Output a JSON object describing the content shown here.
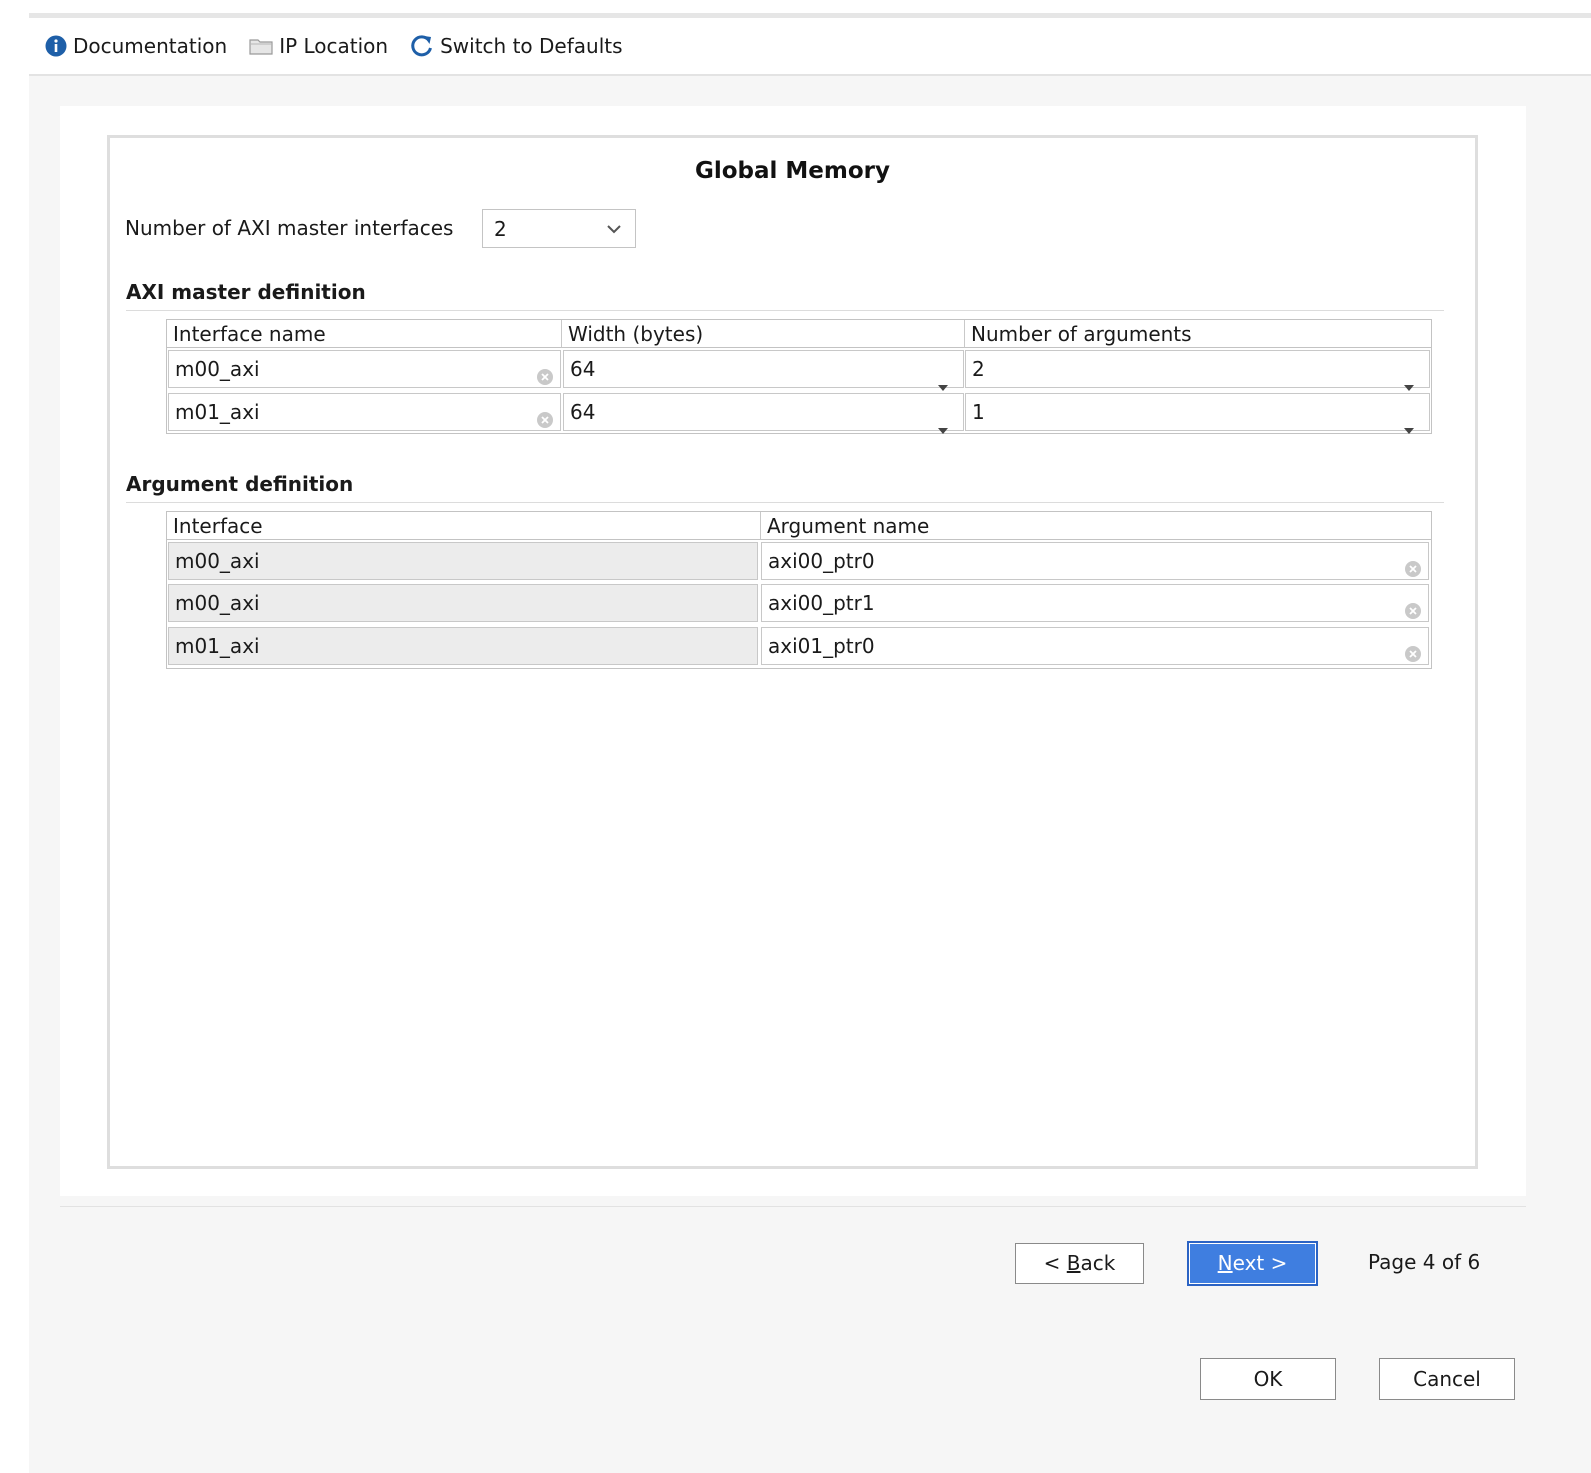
{
  "toolbar": {
    "items": [
      {
        "label": "Documentation",
        "icon": "info-icon"
      },
      {
        "label": "IP Location",
        "icon": "folder-icon"
      },
      {
        "label": "Switch to Defaults",
        "icon": "refresh-icon"
      }
    ]
  },
  "panel": {
    "title": "Global Memory",
    "num_interfaces_label": "Number of AXI master interfaces",
    "num_interfaces_value": "2"
  },
  "axi_section": {
    "heading": "AXI master definition",
    "columns": [
      "Interface name",
      "Width (bytes)",
      "Number of arguments"
    ],
    "rows": [
      {
        "name": "m00_axi",
        "width": "64",
        "num_args": "2"
      },
      {
        "name": "m01_axi",
        "width": "64",
        "num_args": "1"
      }
    ]
  },
  "arg_section": {
    "heading": "Argument definition",
    "columns": [
      "Interface",
      "Argument name"
    ],
    "rows": [
      {
        "interface": "m00_axi",
        "arg": "axi00_ptr0"
      },
      {
        "interface": "m00_axi",
        "arg": "axi00_ptr1"
      },
      {
        "interface": "m01_axi",
        "arg": "axi01_ptr0"
      }
    ]
  },
  "nav": {
    "back_prefix": "< ",
    "back_mnemonic": "B",
    "back_rest": "ack",
    "next_mnemonic": "N",
    "next_rest": "ext >",
    "page_indicator": "Page 4 of 6",
    "ok_label": "OK",
    "cancel_label": "Cancel"
  },
  "colors": {
    "accent": "#3f7ee0",
    "info_icon": "#1e5fa8"
  }
}
